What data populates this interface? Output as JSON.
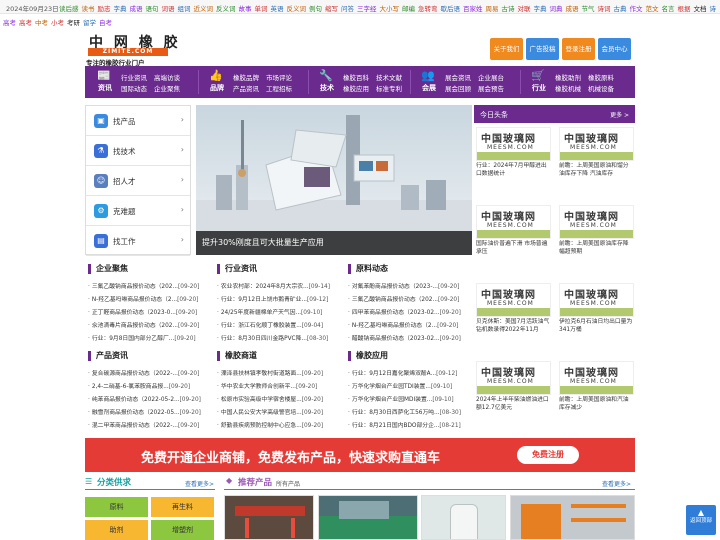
{
  "topbar": {
    "date": "2024年09月23日",
    "links": [
      {
        "t": "读后感",
        "c": "#2b8a2b"
      },
      {
        "t": "读书",
        "c": "#c06000"
      },
      {
        "t": "励志",
        "c": "#d03030"
      },
      {
        "t": "字典",
        "c": "#2b6db5"
      },
      {
        "t": "成语",
        "c": "#8a2be2"
      },
      {
        "t": "语句",
        "c": "#2b8a2b"
      },
      {
        "t": "词语",
        "c": "#d03030"
      },
      {
        "t": "组词",
        "c": "#2b6db5"
      },
      {
        "t": "近义词",
        "c": "#c06000"
      },
      {
        "t": "反义词",
        "c": "#2b8a2b"
      },
      {
        "t": "故事",
        "c": "#8a2be2"
      },
      {
        "t": "单词",
        "c": "#d03030"
      },
      {
        "t": "英语",
        "c": "#2b6db5"
      },
      {
        "t": "反义词",
        "c": "#c06000"
      },
      {
        "t": "例句",
        "c": "#2b8a2b"
      },
      {
        "t": "缩写",
        "c": "#d03030"
      },
      {
        "t": "问答",
        "c": "#2b6db5"
      },
      {
        "t": "三字经",
        "c": "#8a2be2"
      },
      {
        "t": "大小写",
        "c": "#c06000"
      },
      {
        "t": "邮编",
        "c": "#2b8a2b"
      },
      {
        "t": "急转弯",
        "c": "#d03030"
      },
      {
        "t": "歇后语",
        "c": "#2b6db5"
      },
      {
        "t": "百家姓",
        "c": "#8a2be2"
      },
      {
        "t": "周易",
        "c": "#c06000"
      },
      {
        "t": "古诗",
        "c": "#2b8a2b"
      },
      {
        "t": "对联",
        "c": "#d03030"
      },
      {
        "t": "字典",
        "c": "#2b6db5"
      },
      {
        "t": "词典",
        "c": "#8a2be2"
      },
      {
        "t": "成语",
        "c": "#c06000"
      },
      {
        "t": "节气",
        "c": "#2b8a2b"
      },
      {
        "t": "诗词",
        "c": "#d03030"
      },
      {
        "t": "古典",
        "c": "#2b6db5"
      },
      {
        "t": "作文",
        "c": "#8a2be2"
      },
      {
        "t": "范文",
        "c": "#c06000"
      },
      {
        "t": "名言",
        "c": "#2b8a2b"
      },
      {
        "t": "根据",
        "c": "#d03030"
      },
      {
        "t": "文档",
        "c": "#222"
      },
      {
        "t": "诗词",
        "c": "#2b6db5"
      },
      {
        "t": "函数",
        "c": "#8a2be2"
      },
      {
        "t": "图书",
        "c": "#2b8a2b"
      }
    ],
    "row2": [
      {
        "t": "高考",
        "c": "#8a2be2"
      },
      {
        "t": "高考",
        "c": "#d03030"
      },
      {
        "t": "中考",
        "c": "#c06000"
      },
      {
        "t": "小考",
        "c": "#d03030"
      },
      {
        "t": "考研",
        "c": "#222"
      },
      {
        "t": "留学",
        "c": "#2b6db5"
      },
      {
        "t": "自考",
        "c": "#8a2be2"
      }
    ]
  },
  "logo": {
    "l1": "中 网 橡 胶",
    "l2": "ZIMITE.COM",
    "l3": "专注的橡胶行业门户"
  },
  "topbtns": [
    {
      "label": "关于我们",
      "color": "#f08a1e"
    },
    {
      "label": "广告投稿",
      "color": "#3a8be0"
    },
    {
      "label": "登录注册",
      "color": "#f08a1e"
    },
    {
      "label": "会员中心",
      "color": "#3a8be0"
    }
  ],
  "nav": [
    {
      "name": "资讯",
      "icon": "📰",
      "links": [
        "行业资讯",
        "高端访谈",
        "国际动态",
        "企业聚焦"
      ]
    },
    {
      "name": "品牌",
      "icon": "👍",
      "links": [
        "橡胶品牌",
        "市场评论",
        "产品资讯",
        "工程招标"
      ]
    },
    {
      "name": "技术",
      "icon": "🔧",
      "links": [
        "橡胶百科",
        "技术文献",
        "橡胶应用",
        "标准专利"
      ]
    },
    {
      "name": "会展",
      "icon": "👥",
      "links": [
        "展会资讯",
        "企业展台",
        "展会回顾",
        "展会预告"
      ]
    },
    {
      "name": "行业",
      "icon": "🛒",
      "links": [
        "橡胶助剂",
        "橡胶原料",
        "橡胶机械",
        "机械设备"
      ]
    }
  ],
  "leftmenu": [
    {
      "label": "找产品",
      "color": "#3a8be0",
      "icon": "▣"
    },
    {
      "label": "找技术",
      "color": "#3a6fd8",
      "icon": "⚗"
    },
    {
      "label": "招人才",
      "color": "#5a7fbf",
      "icon": "☺"
    },
    {
      "label": "克难题",
      "color": "#2d9be0",
      "icon": "⚙"
    },
    {
      "label": "找工作",
      "color": "#3a6fd8",
      "icon": "▤"
    }
  ],
  "banner": {
    "caption": "提升30%刚度且可大批量生产应用"
  },
  "sections": [
    {
      "title": "企业聚焦",
      "items": [
        {
          "t": "三氟乙酸钠商品报价动态（202...",
          "d": "[09-20]"
        },
        {
          "t": "N-羟乙基吗啉商品报价动态（2...",
          "d": "[09-20]"
        },
        {
          "t": "正丁醛商品报价动态（2023-0...",
          "d": "[09-20]"
        },
        {
          "t": "氽池滴毒片商品报价动态（202...",
          "d": "[09-20]"
        },
        {
          "t": "行业：9月8日国内部分乙醇厂...",
          "d": "[09-20]"
        }
      ]
    },
    {
      "title": "行业资讯",
      "items": [
        {
          "t": "农业农村部：2024年8月大宗农...",
          "d": "[09-14]"
        },
        {
          "t": "行业：9月12日上饶市鹅青矿业...",
          "d": "[09-12]"
        },
        {
          "t": "24/25年度新疆棉单产天气因...",
          "d": "[09-10]"
        },
        {
          "t": "行业：浙江石化顺丁橡胶装置...",
          "d": "[09-04]"
        },
        {
          "t": "行业：8月30日四川金路PVC降...",
          "d": "[08-30]"
        }
      ]
    },
    {
      "title": "原料动态",
      "items": [
        {
          "t": "对氟苯酚商品报价动态（2023-...",
          "d": "[09-20]"
        },
        {
          "t": "三氟乙酸钠商品报价动态（202...",
          "d": "[09-20]"
        },
        {
          "t": "四甲苯商品报价动态（2023-02...",
          "d": "[09-20]"
        },
        {
          "t": "N-羟乙基吗啉商品报价动态（2...",
          "d": "[09-20]"
        },
        {
          "t": "醋酸钠商品报价动态（2023-02...",
          "d": "[09-20]"
        }
      ]
    },
    {
      "title": "产品资讯",
      "items": [
        {
          "t": "复合碳源商品报价动态（2022-...",
          "d": "[09-20]"
        },
        {
          "t": "2,4-二硝基-6-氯苯胺商品报...",
          "d": "[09-20]"
        },
        {
          "t": "纯苯商品报价动态（2022-05-2...",
          "d": "[09-20]"
        },
        {
          "t": "融雪剂商品报价动态（2022-05...",
          "d": "[09-20]"
        },
        {
          "t": "混二甲苯商品报价动态（2022-...",
          "d": "[09-20]"
        }
      ]
    },
    {
      "title": "橡胶商道",
      "items": [
        {
          "t": "溧泽县扶林镇孝敬村街道路面...",
          "d": "[09-20]"
        },
        {
          "t": "华中农业大学教师合创新平...",
          "d": "[09-20]"
        },
        {
          "t": "松原市实验高级中学宿舍楼屋...",
          "d": "[09-20]"
        },
        {
          "t": "中国人民公安大学高级警官培...",
          "d": "[09-20]"
        },
        {
          "t": "舒勤县疾病预防控制中心应急...",
          "d": "[09-20]"
        }
      ]
    },
    {
      "title": "橡胶应用",
      "items": [
        {
          "t": "行业：9月12日嘉化聚烯双酚A...",
          "d": "[09-12]"
        },
        {
          "t": "万华化学烟台产业园TDI装置...",
          "d": "[09-10]"
        },
        {
          "t": "万华化学烟台产业园MDI装置...",
          "d": "[09-10]"
        },
        {
          "t": "行业：8月30日西萨化工56万吨...",
          "d": "[08-30]"
        },
        {
          "t": "行业：8月21日国内BDO部分企...",
          "d": "[08-21]"
        }
      ]
    }
  ],
  "rightcol": {
    "title": "今日头条",
    "more": "更多 >",
    "brand1": "中国玻璃网",
    "brand2": "MEESM.COM",
    "items": [
      "行业：2024年7月甲醇进出口数据统计",
      "前瞻：上周美国原油和馏分油库存下降 汽油库存",
      "国际油价普遍下滑 市场普遍承压",
      "前瞻：上周美国原油库存降幅超预期",
      "贝克休斯：美国7月活跃油气钻机数录得2022年11月",
      "伊拉克6月石油日均出口量为341万桶",
      "2024年上半年柴油燃油进口额12.7亿美元",
      "前瞻：上周美国原油和汽油库存减少"
    ]
  },
  "ad": {
    "text": "免费开通企业商铺，免费发布产品，快速求购直通车",
    "btn": "免费注册"
  },
  "bottom": {
    "cat_title": "分类供求",
    "cat_more": "查看更多>",
    "prod_title": "推荐产品",
    "prod_sub": "所有产品",
    "prod_more": "查看更多>",
    "cats": [
      {
        "t": "原料",
        "c": "#8dc63f"
      },
      {
        "t": "再生料",
        "c": "#f7b731"
      },
      {
        "t": "助剂",
        "c": "#f7b731"
      },
      {
        "t": "增塑剂",
        "c": "#8dc63f"
      }
    ]
  },
  "totop": {
    "label": "返回顶部"
  }
}
